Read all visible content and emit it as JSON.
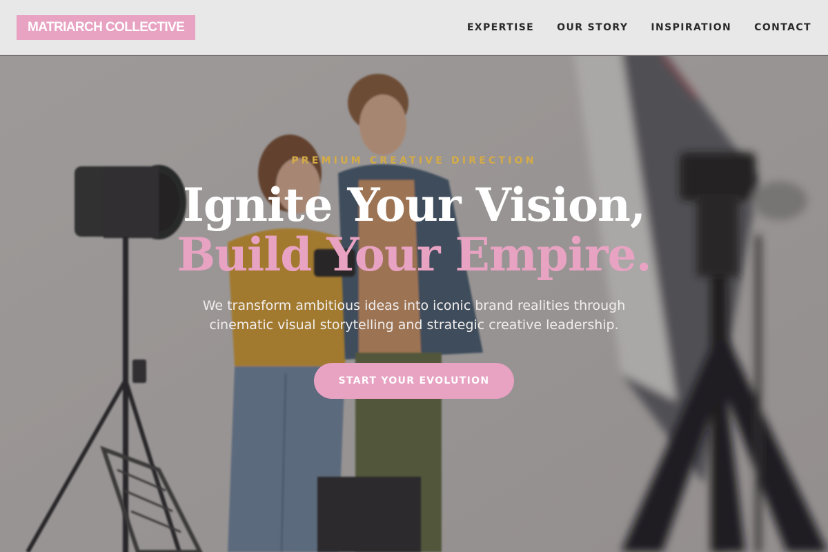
{
  "brand": {
    "name": "MATRIARCH COLLECTIVE"
  },
  "nav": {
    "items": [
      {
        "label": "EXPERTISE"
      },
      {
        "label": "OUR STORY"
      },
      {
        "label": "INSPIRATION"
      },
      {
        "label": "CONTACT"
      }
    ]
  },
  "hero": {
    "eyebrow": "PREMIUM CREATIVE DIRECTION",
    "headline_line1": "Ignite Your Vision,",
    "headline_line2": "Build Your Empire.",
    "subtext": "We transform ambitious ideas into iconic brand realities through cinematic visual storytelling and strategic creative leadership.",
    "cta_label": "START YOUR EVOLUTION",
    "background_image": "photo-studio-scene"
  },
  "colors": {
    "accent_pink": "#e8a2c2",
    "eyebrow_gold": "#d4ab45",
    "header_bg": "#e9e8e8"
  }
}
